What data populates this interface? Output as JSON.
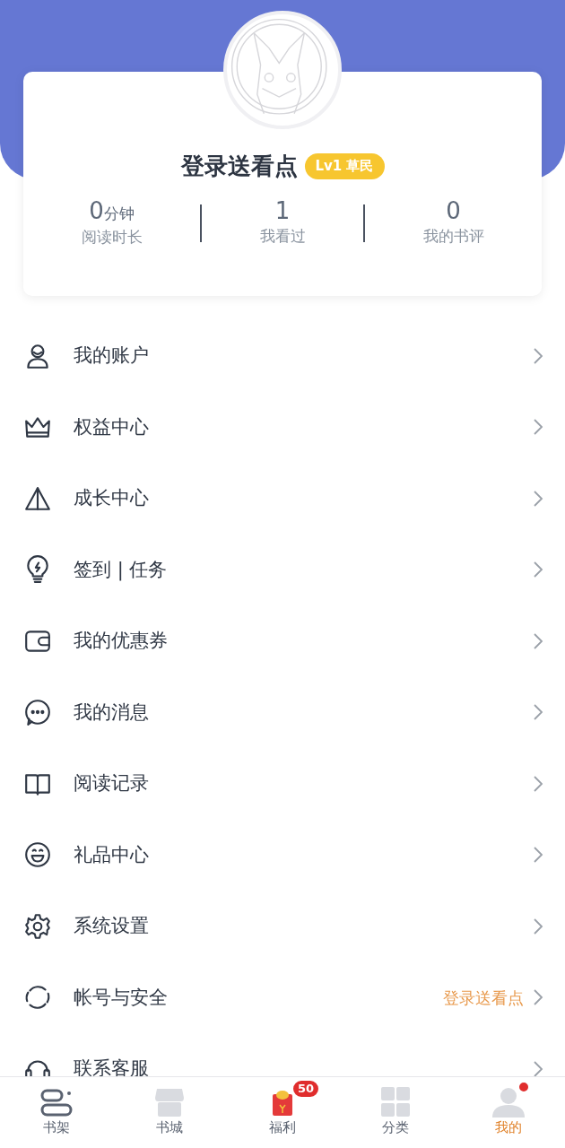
{
  "profile": {
    "name": "登录送看点",
    "level_badge": "Lv1 草民"
  },
  "stats": [
    {
      "value": "0",
      "unit": "分钟",
      "label": "阅读时长"
    },
    {
      "value": "1",
      "label": "我看过"
    },
    {
      "value": "0",
      "label": "我的书评"
    }
  ],
  "menu": [
    {
      "label": "我的账户"
    },
    {
      "label": "权益中心"
    },
    {
      "label": "成长中心"
    },
    {
      "label": "签到 | 任务"
    },
    {
      "label": "我的优惠券"
    },
    {
      "label": "我的消息"
    },
    {
      "label": "阅读记录"
    },
    {
      "label": "礼品中心"
    },
    {
      "label": "系统设置"
    },
    {
      "label": "帐号与安全",
      "note": "登录送看点"
    },
    {
      "label": "联系客服"
    }
  ],
  "tabs": [
    {
      "label": "书架",
      "selected": false
    },
    {
      "label": "书城",
      "selected": false
    },
    {
      "label": "福利",
      "selected": false,
      "badge": "50"
    },
    {
      "label": "分类",
      "selected": false
    },
    {
      "label": "我的",
      "selected": true,
      "dot": true
    }
  ]
}
